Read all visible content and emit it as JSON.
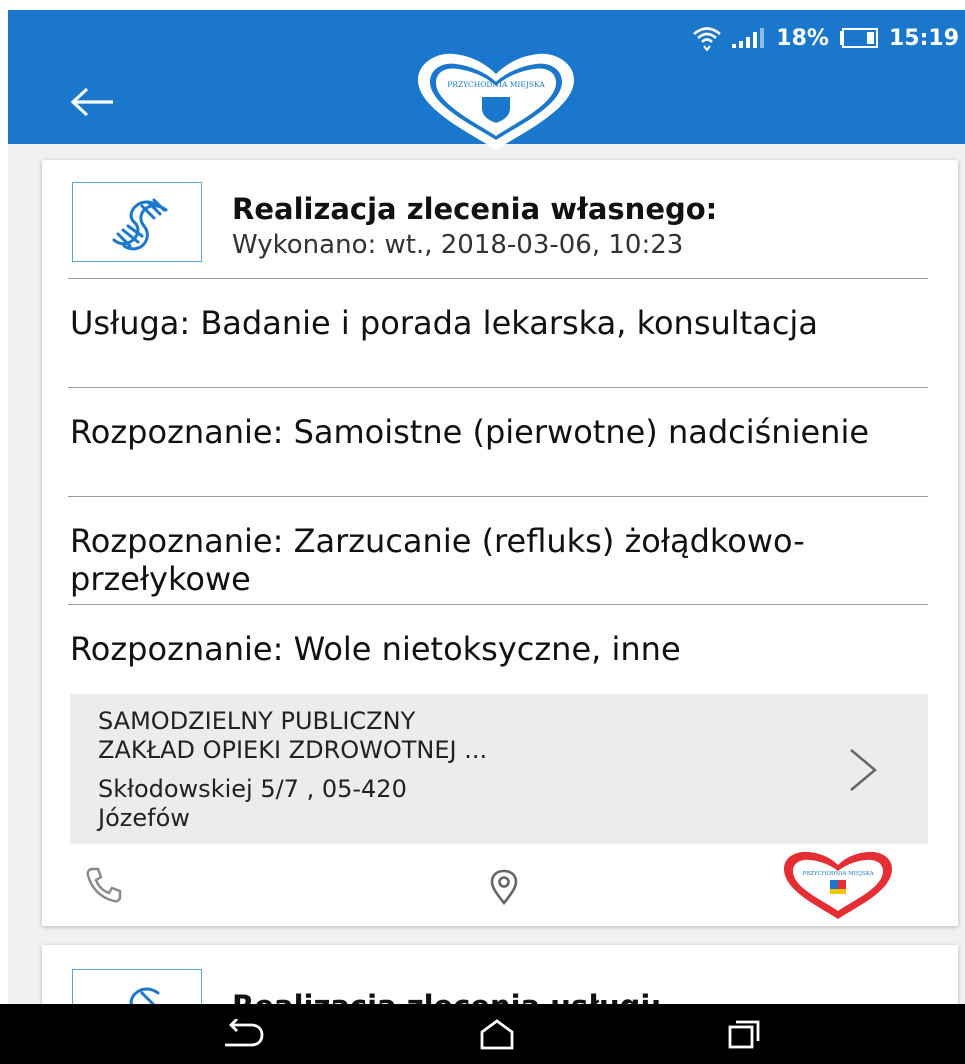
{
  "status_bar": {
    "battery": "18%",
    "time": "15:19",
    "wifi_icon": "wifi-icon",
    "signal_icon": "signal-icon",
    "battery_icon": "battery-icon"
  },
  "app_bar": {
    "back_icon": "arrow-left-icon",
    "logo_text": "PRZYCHODNIA MIEJSKA",
    "color": "#1a77cc"
  },
  "cards": [
    {
      "title": "Realizacja zlecenia własnego:",
      "subtitle": "Wykonano: wt., 2018-03-06, 10:23",
      "icon": "dna-icon",
      "entries": [
        "Usługa: Badanie i porada lekarska, konsultacja",
        "Rozpoznanie: Samoistne (pierwotne) nadciśnienie",
        "Rozpoznanie: Zarzucanie (refluks) żołądkowo-przełykowe",
        "Rozpoznanie: Wole nietoksyczne, inne"
      ],
      "facility": {
        "name_line1": "SAMODZIELNY PUBLICZNY",
        "name_line2": "ZAKŁAD OPIEKI ZDROWOTNEJ ...",
        "address_line1": "Skłodowskiej 5/7 , 05-420",
        "address_line2": "Józefów"
      },
      "actions": [
        "phone-icon",
        "location-pin-icon",
        "clinic-logo-icon"
      ]
    },
    {
      "title": "Realizacja zlecenia usługi:",
      "icon": "dna-icon"
    }
  ],
  "nav_bar": {
    "back_icon": "back-icon",
    "home_icon": "home-icon",
    "recents_icon": "recents-icon"
  },
  "colors": {
    "accent": "#1a77cc",
    "logo_red": "#e52d34"
  }
}
